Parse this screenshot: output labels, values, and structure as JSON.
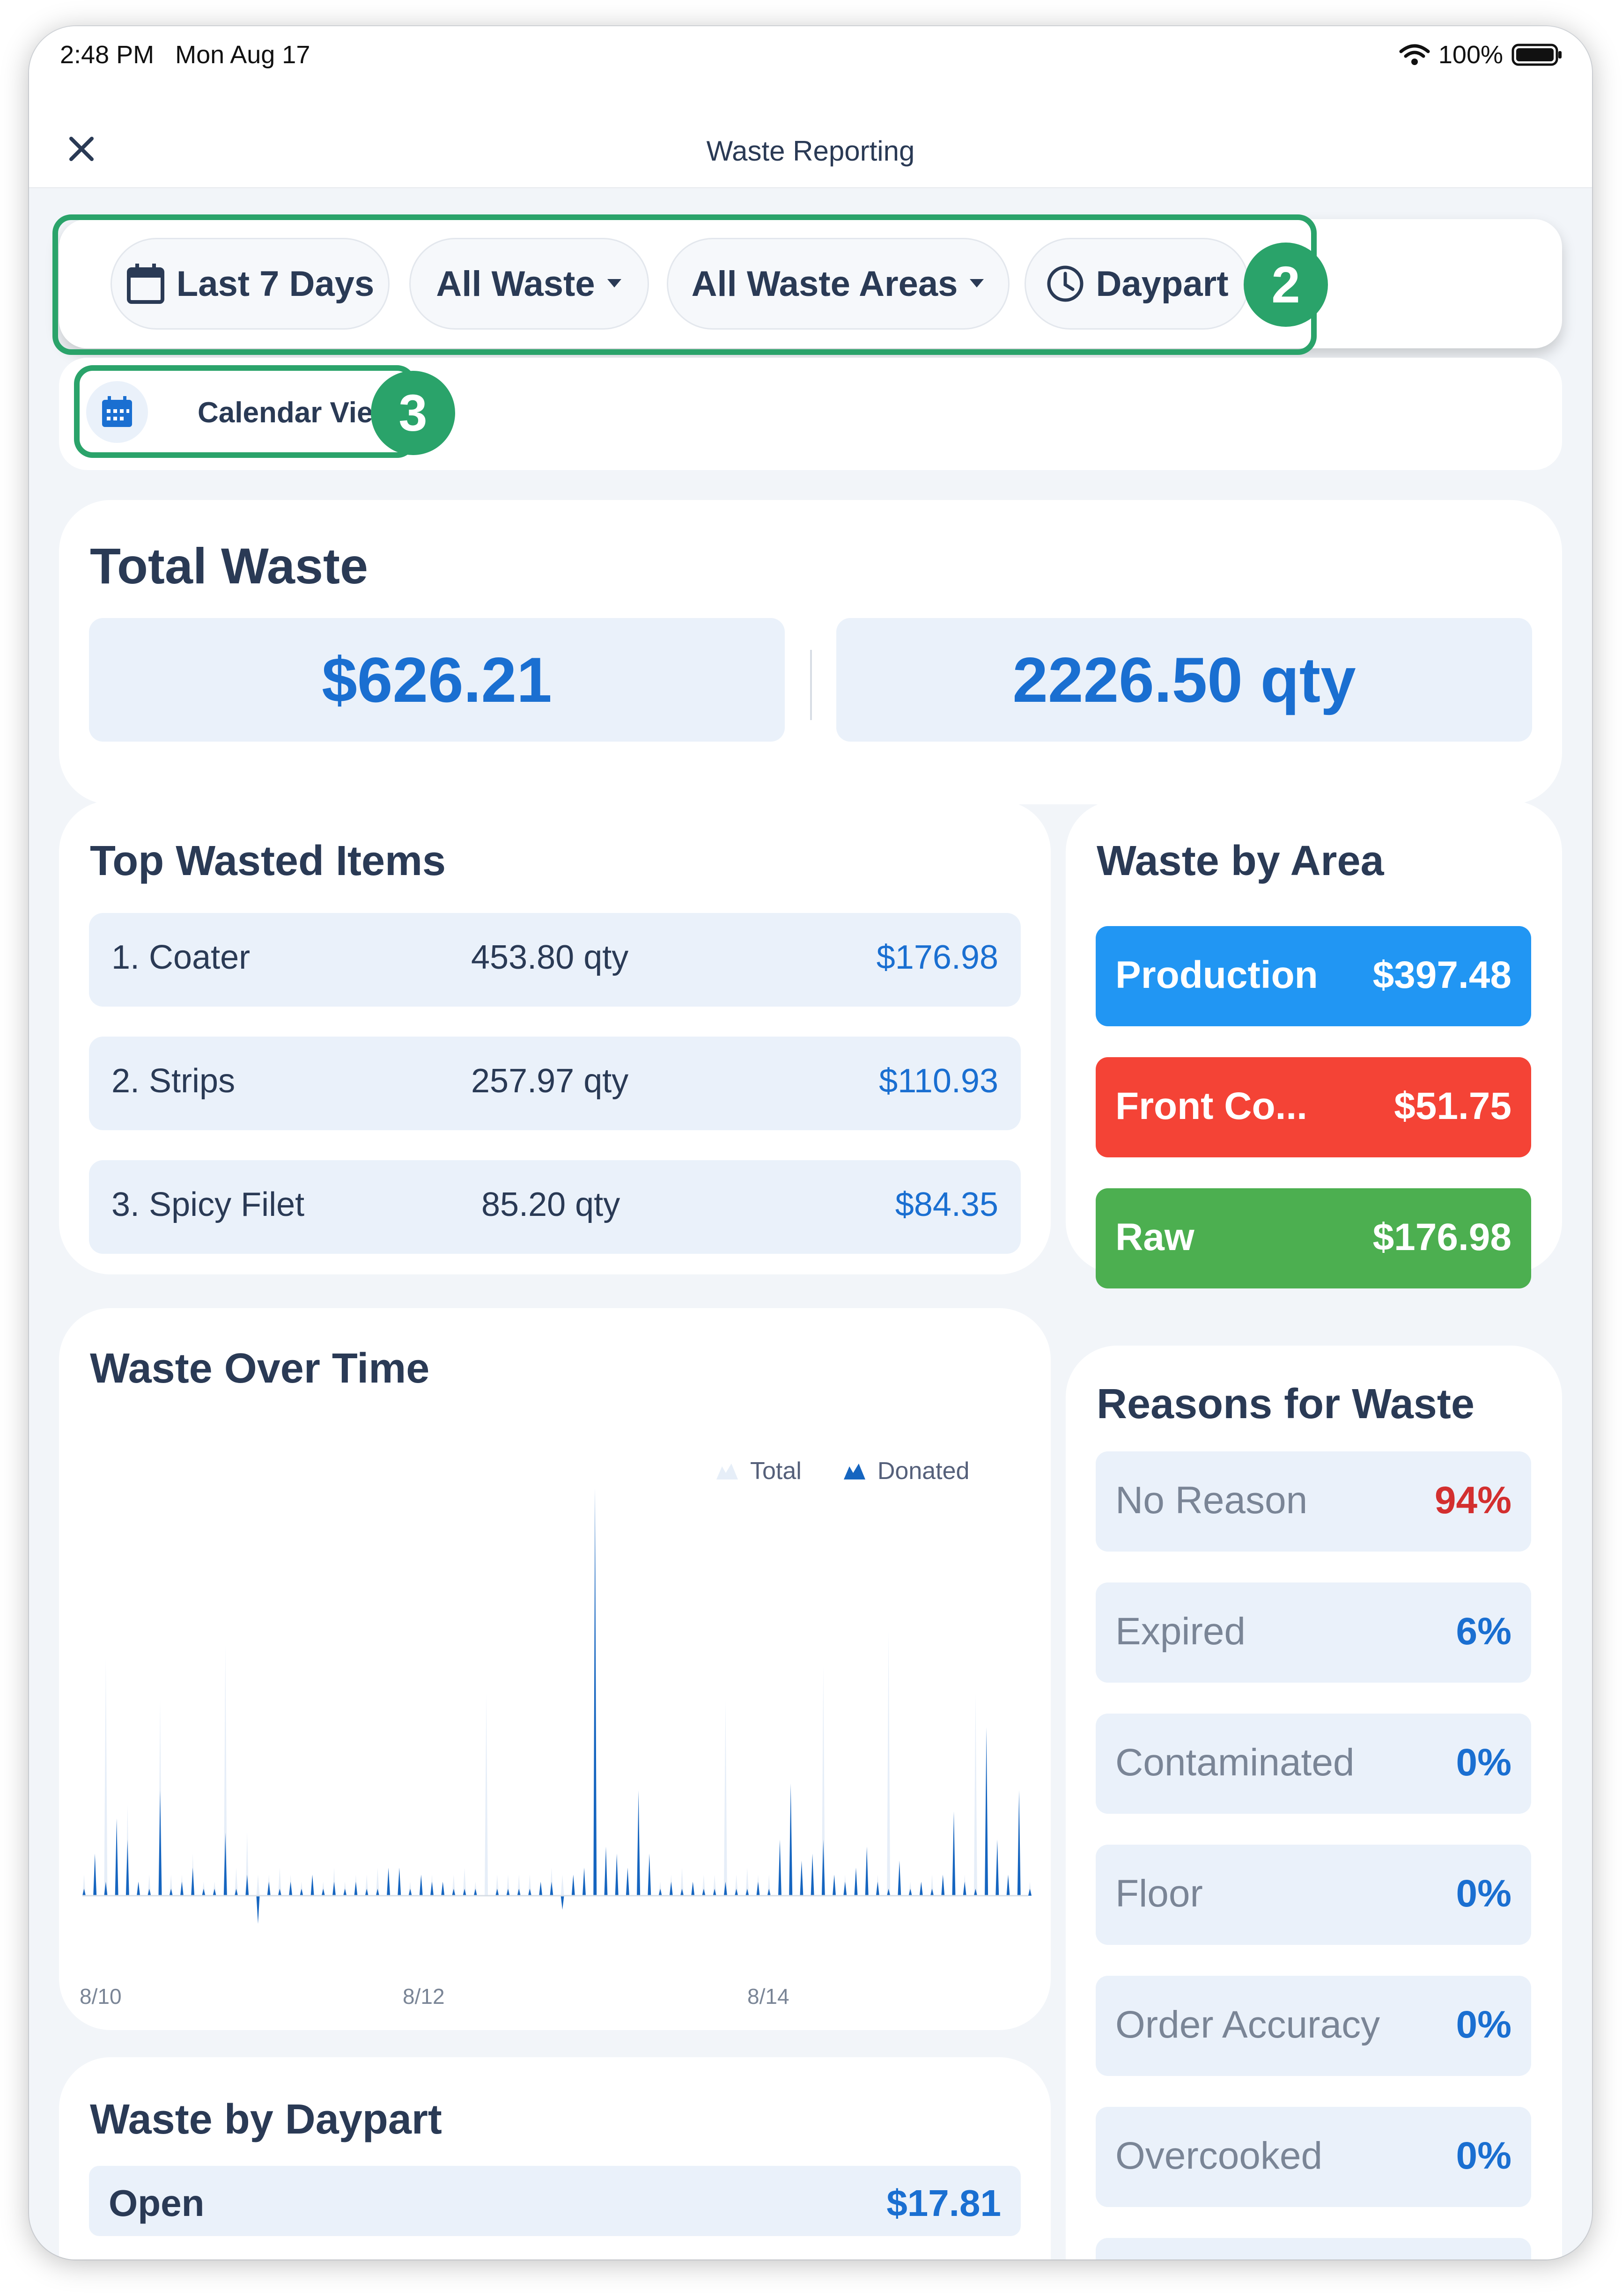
{
  "status_bar": {
    "time": "2:48 PM",
    "date": "Mon Aug 17",
    "battery": "100%"
  },
  "nav": {
    "title": "Waste Reporting",
    "close_icon": "close-icon"
  },
  "filters": [
    {
      "label": "Last 7 Days",
      "icon": "calendar-icon"
    },
    {
      "label": "All Waste",
      "icon": "caret-down-icon"
    },
    {
      "label": "All Waste Areas",
      "icon": "caret-down-icon"
    },
    {
      "label": "Daypart",
      "icon": "clock-icon"
    }
  ],
  "annotations": {
    "badge_filters": "2",
    "badge_calendar": "3",
    "color": "#2aa36a"
  },
  "calendar_view": {
    "label": "Calendar View",
    "icon": "calendar-grid-icon"
  },
  "total_waste": {
    "title": "Total Waste",
    "cost": "$626.21",
    "qty": "2226.50 qty"
  },
  "top_items": {
    "title": "Top Wasted Items",
    "items": [
      {
        "name": "1. Coater",
        "qty": "453.80 qty",
        "cost": "$176.98"
      },
      {
        "name": "2. Strips",
        "qty": "257.97 qty",
        "cost": "$110.93"
      },
      {
        "name": "3. Spicy Filet",
        "qty": "85.20 qty",
        "cost": "$84.35"
      }
    ]
  },
  "waste_by_area": {
    "title": "Waste by Area",
    "areas": [
      {
        "name": "Production",
        "value": "$397.48",
        "color": "#2196f3"
      },
      {
        "name": "Front Co...",
        "value": "$51.75",
        "color": "#f44336"
      },
      {
        "name": "Raw",
        "value": "$176.98",
        "color": "#4caf50"
      }
    ]
  },
  "waste_over_time": {
    "title": "Waste Over Time",
    "legend": {
      "total": "Total",
      "donated": "Donated"
    },
    "x_labels": [
      "8/10",
      "8/12",
      "8/14"
    ]
  },
  "chart_data": {
    "type": "area",
    "title": "Waste Over Time",
    "categories": [
      "8/10",
      "8/12",
      "8/14"
    ],
    "series": [
      {
        "name": "Total",
        "color": "#e6eef8",
        "values": [
          0.3,
          0.2,
          3.4,
          0.4,
          1.3,
          0.2,
          0.3,
          2.8,
          0.3,
          0.3,
          0.6,
          0.2,
          0.2,
          3.6,
          0.4,
          0.9,
          0.3,
          0.3,
          0.4,
          0.3,
          0.2,
          0.3,
          0.2,
          0.4,
          0.2,
          0.3,
          0.3,
          0.4,
          0.2,
          0.3,
          0.2,
          0.3,
          0.3,
          0.2,
          0.3,
          0.4,
          0.2,
          2.9,
          0.3,
          0.3,
          0.3,
          0.3,
          0.2,
          0.4,
          0.3,
          0.3,
          0.3,
          0.2,
          0.3,
          0.2,
          0.4,
          0.3,
          0.2,
          0.2,
          0.3,
          0.4,
          0.2,
          0.3,
          0.3,
          2.8,
          0.3,
          0.4,
          0.3,
          0.3,
          0.4,
          0.2,
          0.3,
          0.3,
          3.3,
          0.3,
          0.3,
          0.3,
          0.2,
          0.3,
          3.8,
          0.3,
          0.2,
          0.2,
          0.3,
          0.2,
          1.2,
          0.3,
          2.9,
          0.2,
          0.3,
          0.2,
          0.2,
          0.2
        ]
      },
      {
        "name": "Donated",
        "color": "#1565c0",
        "values": [
          0.1,
          0.6,
          0.2,
          1.1,
          0.8,
          0.2,
          0.1,
          1.5,
          0.1,
          0.2,
          0.4,
          0.1,
          0.1,
          0.9,
          0.1,
          0.3,
          -0.4,
          0.2,
          0.1,
          0.2,
          0.1,
          0.3,
          0.1,
          0.2,
          0.1,
          0.2,
          0.1,
          0.1,
          0.4,
          0.4,
          0.1,
          0.3,
          0.2,
          0.2,
          0.1,
          0.1,
          0.1,
          0.0,
          0.1,
          0.1,
          0.1,
          0.1,
          0.2,
          0.2,
          -0.2,
          0.3,
          0.4,
          5.8,
          0.7,
          0.6,
          0.4,
          1.5,
          0.6,
          0.1,
          0.2,
          0.1,
          0.2,
          0.1,
          0.1,
          0.2,
          0.1,
          0.1,
          0.2,
          0.1,
          0.8,
          1.6,
          0.5,
          0.6,
          0.8,
          0.3,
          0.2,
          0.4,
          0.7,
          0.2,
          0.1,
          0.5,
          0.1,
          0.2,
          0.1,
          0.3,
          1.2,
          0.2,
          0.1,
          2.4,
          0.8,
          0.3,
          1.5,
          0.1
        ]
      }
    ],
    "legend_position": "top-right"
  },
  "daypart": {
    "title": "Waste by Daypart",
    "rows": [
      {
        "name": "Open",
        "value": "$17.81"
      }
    ]
  },
  "reasons": {
    "title": "Reasons for Waste",
    "items": [
      {
        "name": "No Reason",
        "pct": "94%",
        "color": "#d32f2f"
      },
      {
        "name": "Expired",
        "pct": "6%",
        "color": "#1a6fd1"
      },
      {
        "name": "Contaminated",
        "pct": "0%",
        "color": "#1a6fd1"
      },
      {
        "name": "Floor",
        "pct": "0%",
        "color": "#1a6fd1"
      },
      {
        "name": "Order Accuracy",
        "pct": "0%",
        "color": "#1a6fd1"
      },
      {
        "name": "Overcooked",
        "pct": "0%",
        "color": "#1a6fd1"
      }
    ]
  }
}
